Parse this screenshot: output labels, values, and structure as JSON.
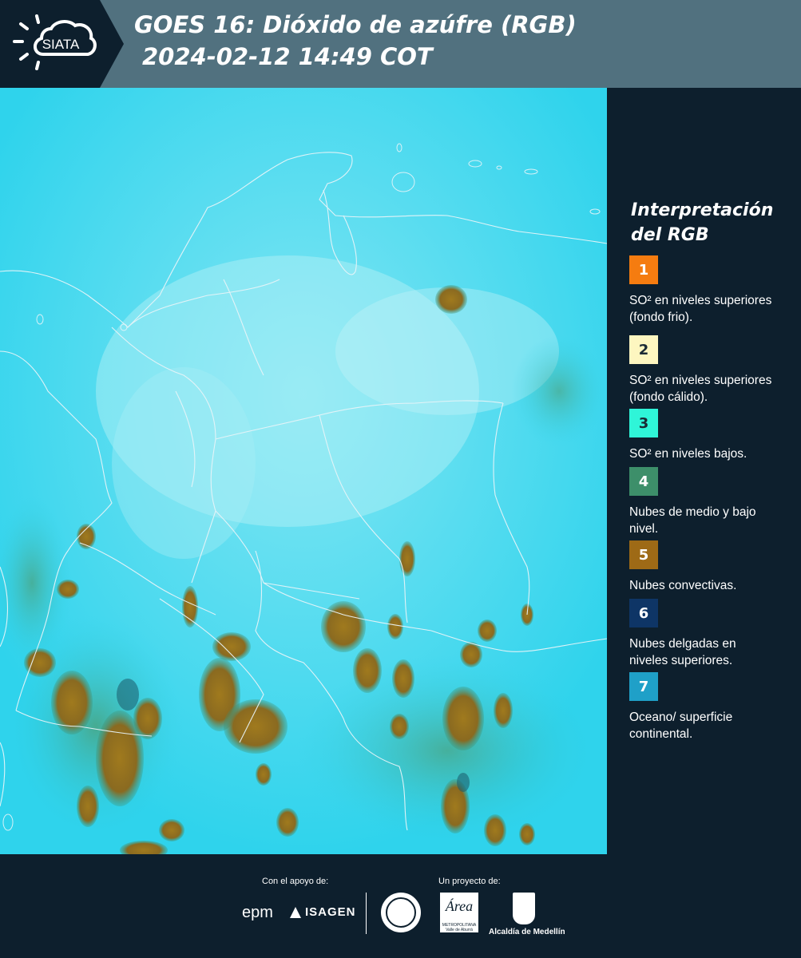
{
  "header": {
    "logo_text": "SIATA",
    "title_line1": "GOES 16: Dióxido de azúfre (RGB)",
    "title_line2": "2024-02-12 14:49 COT"
  },
  "legend": {
    "title": "Interpretación del RGB",
    "items": [
      {
        "number": "1",
        "color": "#f57c10",
        "text_color": "#ffffff",
        "description": "SO² en niveles superiores (fondo frio)."
      },
      {
        "number": "2",
        "color": "#fdf6c0",
        "text_color": "#1a2a35",
        "description": "SO² en niveles superiores (fondo cálido)."
      },
      {
        "number": "3",
        "color": "#2ff5d8",
        "text_color": "#1a2a35",
        "description": "SO² en niveles bajos."
      },
      {
        "number": "4",
        "color": "#3d8f6a",
        "text_color": "#ffffff",
        "description": "Nubes de medio y bajo nivel."
      },
      {
        "number": "5",
        "color": "#9e6a16",
        "text_color": "#ffffff",
        "description": "Nubes convectivas."
      },
      {
        "number": "6",
        "color": "#0e3566",
        "text_color": "#ffffff",
        "description": "Nubes delgadas en niveles superiores."
      },
      {
        "number": "7",
        "color": "#1fa0c8",
        "text_color": "#ffffff",
        "description": "Oceano/ superficie continental."
      }
    ]
  },
  "footer": {
    "support_label": "Con el apoyo de:",
    "project_label": "Un proyecto de:",
    "sponsor_1": "epm",
    "sponsor_2": "ISAGEN",
    "partner_area": "Área",
    "partner_area_sub": "METROPOLITANA Valle de Aburrá",
    "partner_alcaldia": "Alcaldía de Medellín"
  },
  "colors": {
    "header_bg": "#51717f",
    "panel_bg": "#0d1f2d",
    "map_base": "#2fd3ec",
    "cloud_convective": "#9e6a16",
    "border_lines": "#e8f4f8"
  }
}
